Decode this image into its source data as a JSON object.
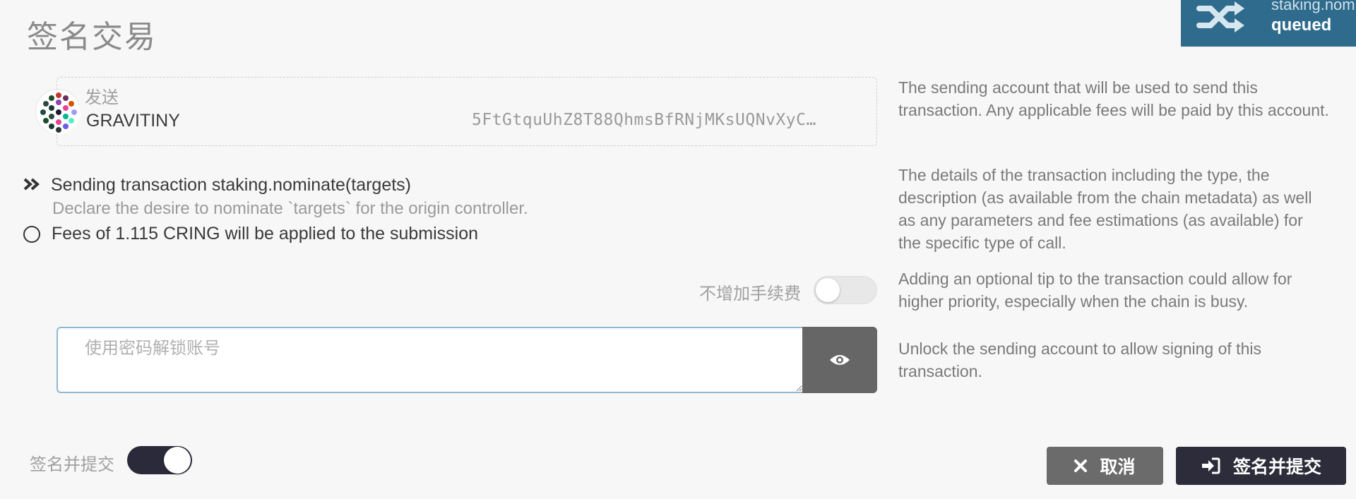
{
  "modal": {
    "title": "签名交易"
  },
  "toast": {
    "method": "staking.nominate",
    "status": "queued",
    "icon": "shuffle-icon",
    "color": "#2f6b8c"
  },
  "sender": {
    "label": "发送",
    "name": "GRAVITINY",
    "address": "5FtGtquUhZ8T88QhmsBfRNjMKsUQNvXyC…"
  },
  "help": {
    "sender": "The sending account that will be used to send this transaction. Any applicable fees will be paid by this account.",
    "details": "The details of the transaction including the type, the description (as available from the chain metadata) as well as any parameters and fee estimations (as available) for the specific type of call.",
    "tip": "Adding an optional tip to the transaction could allow for higher priority, especially when the chain is busy.",
    "unlock": "Unlock the sending account to allow signing of this transaction."
  },
  "transaction": {
    "call_text": "Sending transaction staking.nominate(targets)",
    "description": "Declare the desire to nominate `targets` for the origin controller.",
    "fee_text": "Fees of 1.115 CRING will be applied to the submission"
  },
  "tip": {
    "label": "不增加手续费",
    "enabled": false
  },
  "password": {
    "placeholder": "使用密码解锁账号",
    "value": "",
    "toggle_icon": "eye-icon"
  },
  "sign_toggle": {
    "label": "签名并提交",
    "enabled": true
  },
  "actions": {
    "cancel_label": "取消",
    "submit_label": "签名并提交",
    "cancel_color": "#6b6b6b",
    "submit_color": "#2c2c3a"
  }
}
